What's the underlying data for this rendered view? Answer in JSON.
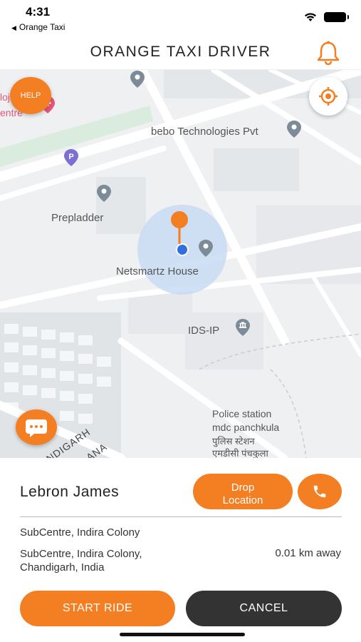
{
  "status_bar": {
    "time": "4:31",
    "back_app": "Orange Taxi"
  },
  "header": {
    "title": "ORANGE TAXI DRIVER",
    "icon": "bell-icon"
  },
  "map": {
    "help_label": "HELP",
    "labels": {
      "partial_top_left_1": "lojr",
      "partial_top_left_2": "entre",
      "bebo": "bebo Technologies Pvt",
      "prepladder": "Prepladder",
      "netsmartz": "Netsmartz House",
      "ids": "IDS-IP",
      "police_1": "Police station",
      "police_2": "mdc panchkula",
      "police_3": "पुलिस स्टेशन",
      "police_4": "एमडीसी पंचकुला",
      "road_1": "NDIGARH",
      "road_2": "ANA"
    },
    "colors": {
      "accent": "#f47e22",
      "road": "#ffffff",
      "park": "#d9ecdd",
      "user_dot": "#2f6fe0"
    }
  },
  "ride": {
    "rider_name": "Lebron James",
    "drop_location_label_1": "Drop",
    "drop_location_label_2": "Location",
    "pickup_address": "SubCentre, Indira Colony",
    "drop_address_1": "SubCentre, Indira Colony,",
    "drop_address_2": "Chandigarh, India",
    "distance": "0.01 km away"
  },
  "actions": {
    "start_label": "START RIDE",
    "cancel_label": "CANCEL"
  }
}
